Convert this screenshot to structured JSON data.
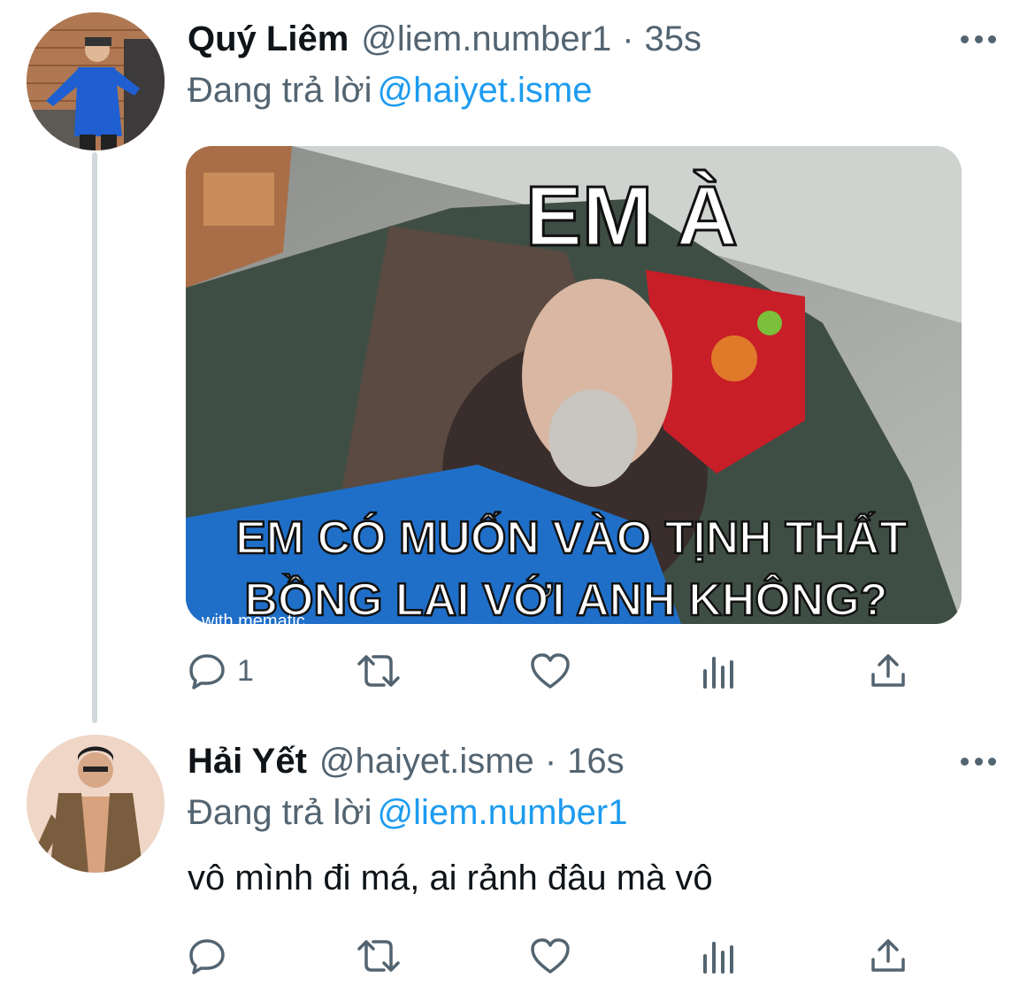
{
  "thread": [
    {
      "display_name": "Quý Liêm",
      "handle": "@liem.number1",
      "separator": "·",
      "time": "35s",
      "reply_prefix": "Đang trả lời",
      "reply_to": "@haiyet.isme",
      "media": {
        "top_caption": "EM À",
        "bottom_caption_line1": "EM CÓ MUỐN VÀO TỊNH THẤT",
        "bottom_caption_line2": "BỒNG LAI VỚI ANH KHÔNG?",
        "watermark": "with mematic"
      },
      "reply_count": "1",
      "icons": [
        "reply-icon",
        "retweet-icon",
        "like-icon",
        "analytics-icon",
        "share-icon",
        "more-icon"
      ]
    },
    {
      "display_name": "Hải Yết",
      "handle": "@haiyet.isme",
      "separator": "·",
      "time": "16s",
      "reply_prefix": "Đang trả lời",
      "reply_to": "@liem.number1",
      "text": "vô mình đi má, ai rảnh đâu mà vô",
      "reply_count": "",
      "icons": [
        "reply-icon",
        "retweet-icon",
        "like-icon",
        "analytics-icon",
        "share-icon",
        "more-icon"
      ]
    }
  ],
  "colors": {
    "text_primary": "#0f1419",
    "text_secondary": "#536471",
    "link": "#1d9bf0",
    "thread_line": "#cfd9de"
  }
}
